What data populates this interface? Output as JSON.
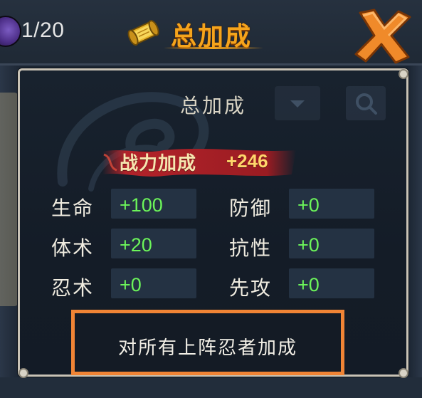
{
  "header": {
    "counter": "1/20",
    "title": "总加成"
  },
  "panel": {
    "title": "总加成",
    "power": {
      "label": "战力加成",
      "value": "+246"
    },
    "stats": {
      "left": [
        {
          "label": "生命",
          "value": "+100"
        },
        {
          "label": "体术",
          "value": "+20"
        },
        {
          "label": "忍术",
          "value": "+0"
        }
      ],
      "right": [
        {
          "label": "防御",
          "value": "+0"
        },
        {
          "label": "抗性",
          "value": "+0"
        },
        {
          "label": "先攻",
          "value": "+0"
        }
      ]
    },
    "note": "对所有上阵忍者加成"
  },
  "colors": {
    "title_orange": "#f5a41c",
    "stat_green": "#6cf55a",
    "note_border": "#f08435",
    "banner_red": "#b3232a"
  },
  "icons": [
    "purple-orb-icon",
    "scroll-icon",
    "close-x-icon",
    "search-icon",
    "dropdown-icon"
  ]
}
